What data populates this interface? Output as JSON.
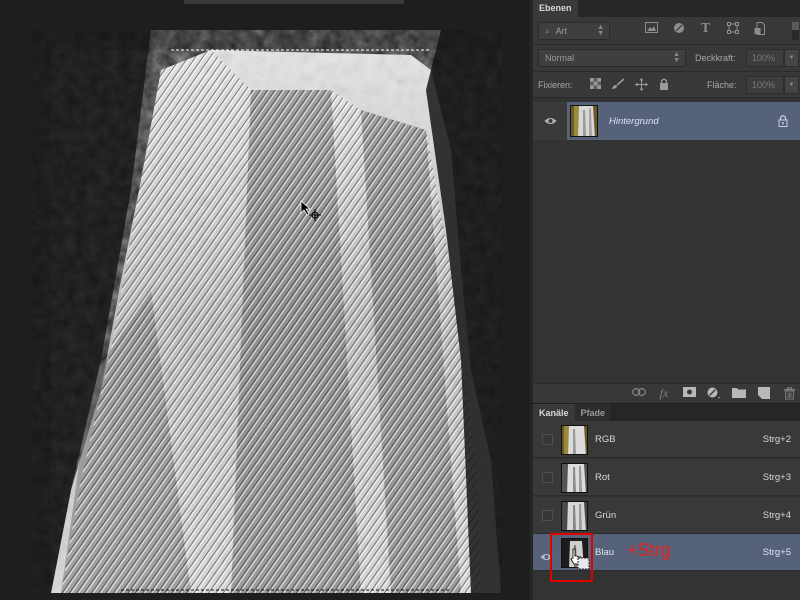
{
  "canvas": {
    "image_description": "Waterfall image in blue-channel grayscale with marching-ants selection",
    "cursor": "arrow-with-move-crosshair"
  },
  "layers_panel": {
    "tab_label": "Ebenen",
    "filter": {
      "search_icon": "search-icon",
      "value": "Art",
      "icons": [
        "image-filter-icon",
        "adjustment-filter-icon",
        "text-filter-icon",
        "shape-filter-icon",
        "smartobject-filter-icon"
      ]
    },
    "blend_mode": "Normal",
    "opacity_label": "Deckkraft:",
    "opacity_value": "100%",
    "lock_label": "Fixieren:",
    "lock_icons": [
      "lock-transparency-icon",
      "lock-pixels-icon",
      "lock-position-icon",
      "lock-all-icon"
    ],
    "fill_label": "Fläche:",
    "fill_value": "100%",
    "layers": [
      {
        "name": "Hintergrund",
        "visible": true,
        "locked": true,
        "selected": true
      }
    ],
    "footer_icons": [
      "link-icon",
      "fx-icon",
      "mask-icon",
      "adjustment-layer-icon",
      "group-folder-icon",
      "new-layer-icon",
      "trash-icon"
    ],
    "footer_glyphs": {
      "link": "⊂⊃",
      "fx": "fx",
      "trash": "🗑"
    }
  },
  "channels_panel": {
    "tabs": [
      {
        "label": "Kanäle",
        "active": true
      },
      {
        "label": "Pfade",
        "active": false
      }
    ],
    "channels": [
      {
        "name": "RGB",
        "shortcut": "Strg+2",
        "visible": false,
        "selected": false
      },
      {
        "name": "Rot",
        "shortcut": "Strg+3",
        "visible": false,
        "selected": false
      },
      {
        "name": "Grün",
        "shortcut": "Strg+4",
        "visible": false,
        "selected": false
      },
      {
        "name": "Blau",
        "shortcut": "Strg+5",
        "visible": true,
        "selected": true
      }
    ],
    "annotation": "+Strg",
    "highlight_color": "#e00000"
  },
  "colors": {
    "panel_bg": "#323232",
    "selected_row": "#56627a",
    "canvas_bg": "#1e1e1e",
    "annotation": "#e32222"
  }
}
